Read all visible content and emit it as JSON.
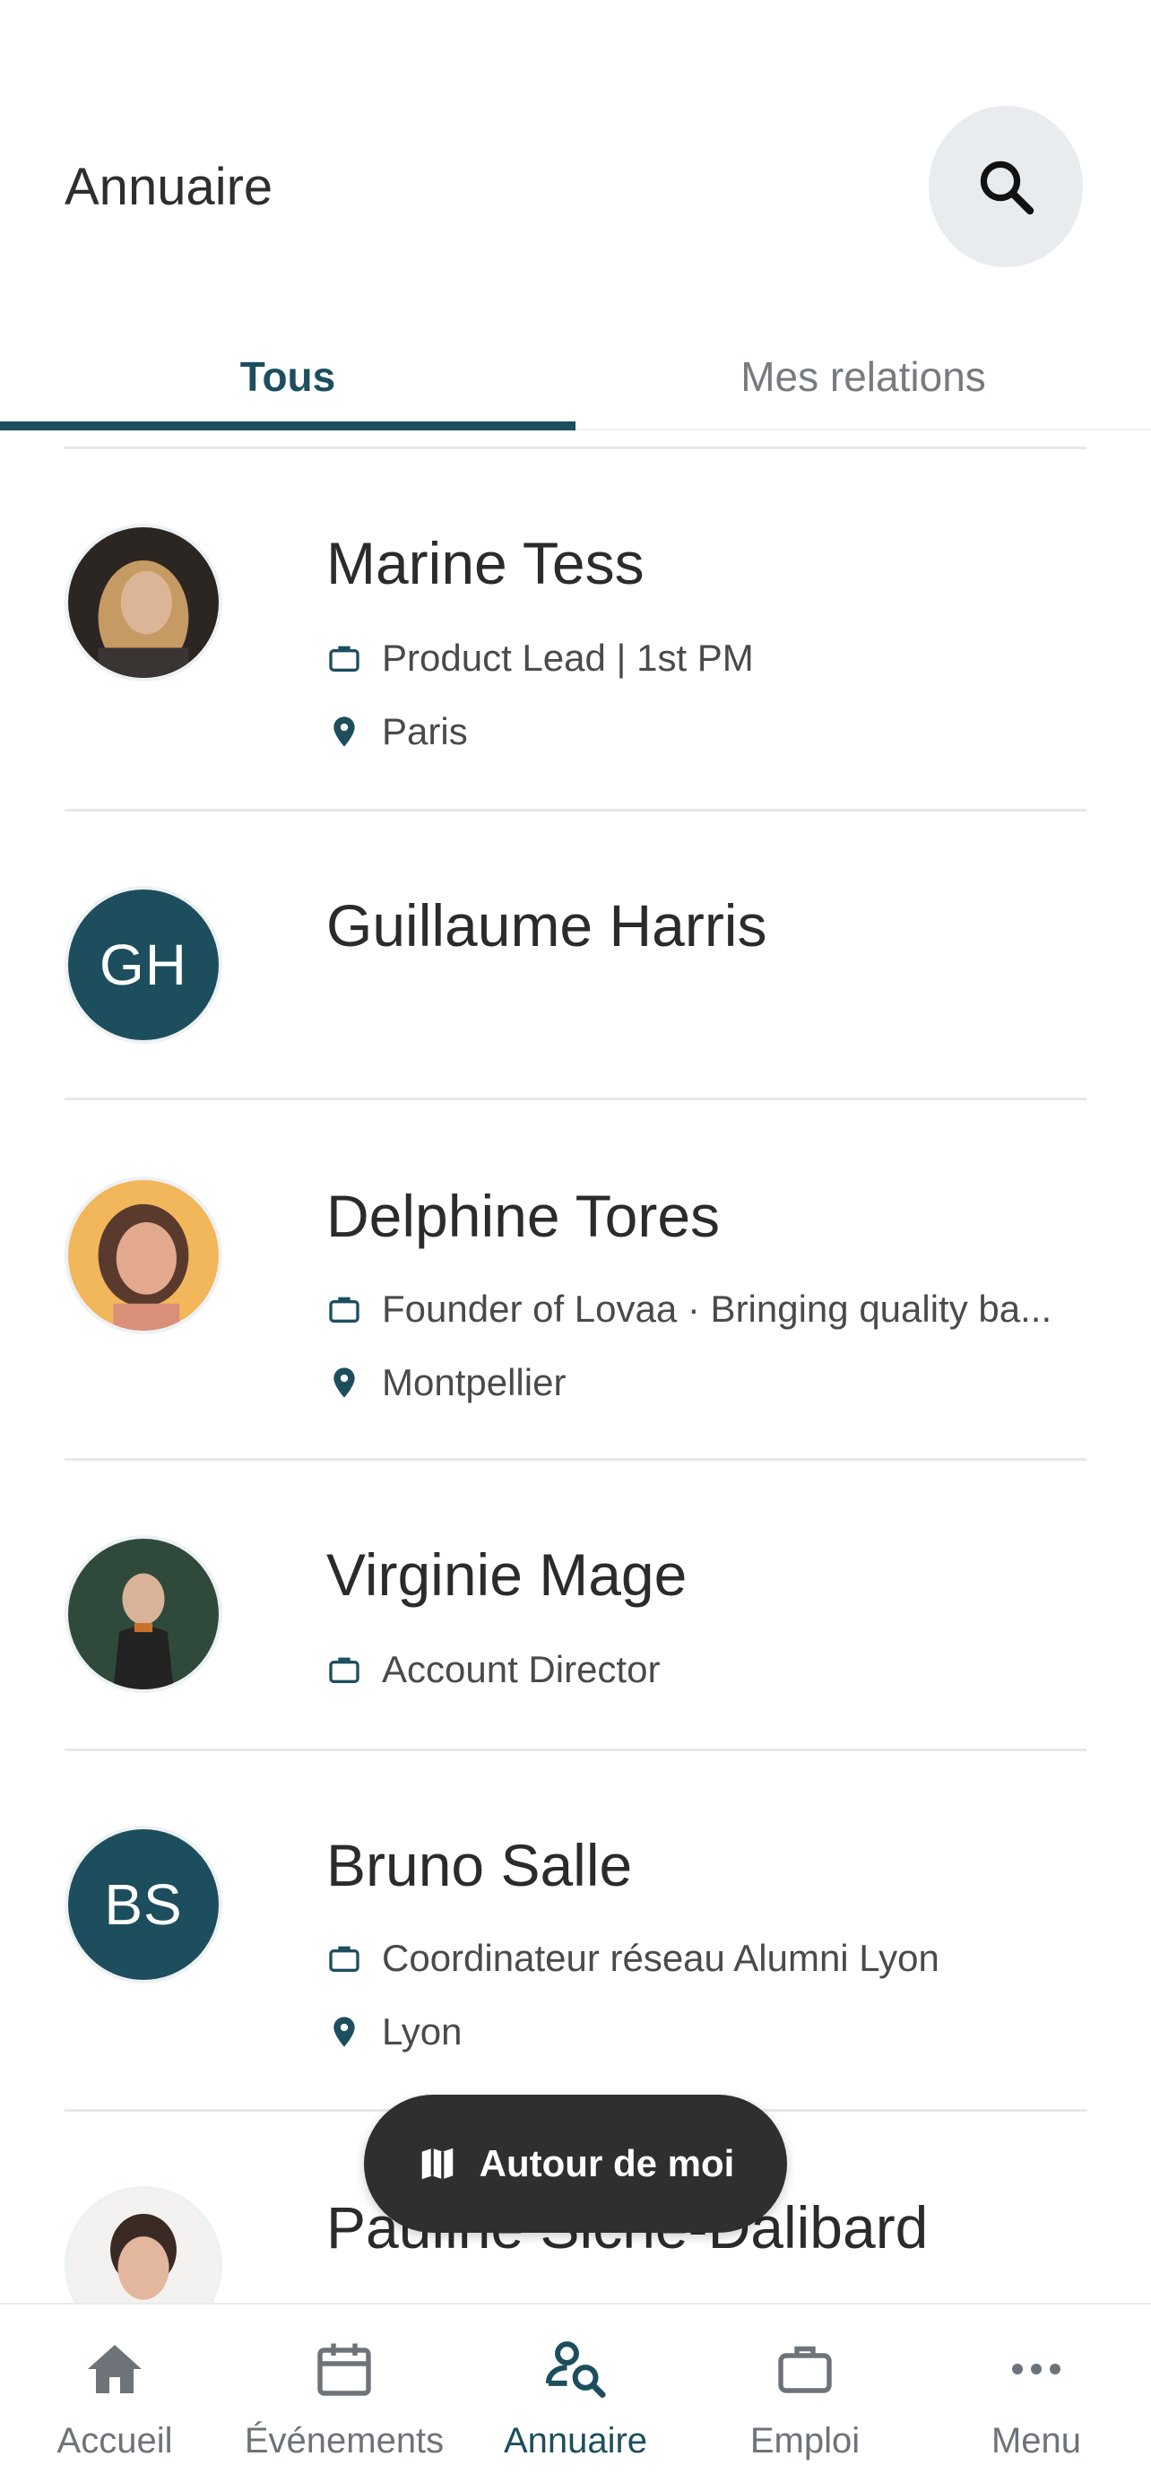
{
  "header": {
    "title": "Annuaire"
  },
  "tabs": [
    {
      "label": "Tous",
      "active": true
    },
    {
      "label": "Mes relations",
      "active": false
    }
  ],
  "people": [
    {
      "name": "Marine Tess",
      "job": "Product Lead | 1st PM",
      "location": "Paris",
      "avatar": "photo"
    },
    {
      "name": "Guillaume Harris",
      "initials": "GH",
      "avatar": "initials"
    },
    {
      "name": "Delphine Tores",
      "job": "Founder of Lovaa · Bringing quality ba...",
      "location": "Montpellier",
      "avatar": "photo"
    },
    {
      "name": "Virginie Mage",
      "job": "Account Director",
      "avatar": "photo"
    },
    {
      "name": "Bruno Salle",
      "initials": "BS",
      "job": "Coordinateur réseau Alumni Lyon",
      "location": "Lyon",
      "avatar": "initials"
    },
    {
      "name": "Pauline Siche-Dalibard",
      "avatar": "photo"
    }
  ],
  "fab": {
    "label": "Autour de moi",
    "icon": "map-icon"
  },
  "nav": [
    {
      "label": "Accueil",
      "icon": "home-icon"
    },
    {
      "label": "Événements",
      "icon": "calendar-icon"
    },
    {
      "label": "Annuaire",
      "icon": "directory-search-icon",
      "active": true
    },
    {
      "label": "Emploi",
      "icon": "briefcase-icon"
    },
    {
      "label": "Menu",
      "icon": "more-icon"
    }
  ],
  "colors": {
    "accent": "#1d4e5e",
    "fab": "#2f2f2f",
    "search_bg": "#e8ecef"
  }
}
